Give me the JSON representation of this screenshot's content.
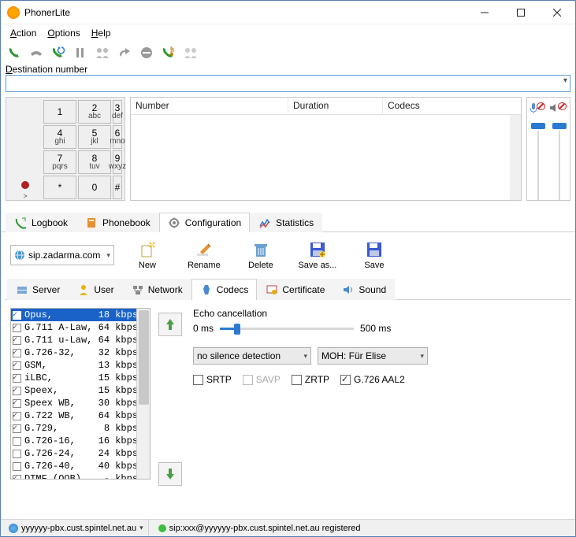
{
  "window": {
    "title": "PhonerLite"
  },
  "menu": {
    "action": "Action",
    "options": "Options",
    "help": "Help"
  },
  "dest_label": "Destination number",
  "keypad": [
    {
      "d": "1",
      "l": ""
    },
    {
      "d": "2",
      "l": "abc"
    },
    {
      "d": "3",
      "l": "def"
    },
    {
      "d": "4",
      "l": "ghi"
    },
    {
      "d": "5",
      "l": "jkl"
    },
    {
      "d": "6",
      "l": "mno"
    },
    {
      "d": "7",
      "l": "pqrs"
    },
    {
      "d": "8",
      "l": "tuv"
    },
    {
      "d": "9",
      "l": "wxyz"
    },
    {
      "d": "*",
      "l": ""
    },
    {
      "d": "0",
      "l": ""
    },
    {
      "d": "#",
      "l": ""
    }
  ],
  "call_columns": {
    "number": "Number",
    "duration": "Duration",
    "codecs": "Codecs"
  },
  "tabs": {
    "logbook": "Logbook",
    "phonebook": "Phonebook",
    "configuration": "Configuration",
    "statistics": "Statistics"
  },
  "profile": {
    "selected": "sip.zadarma.com"
  },
  "profile_actions": {
    "new": "New",
    "rename": "Rename",
    "delete": "Delete",
    "saveas": "Save as...",
    "save": "Save"
  },
  "subtabs": {
    "server": "Server",
    "user": "User",
    "network": "Network",
    "codecs": "Codecs",
    "certificate": "Certificate",
    "sound": "Sound"
  },
  "codecs": [
    {
      "checked": true,
      "name": "Opus,",
      "rate": "18 kbps",
      "sel": true
    },
    {
      "checked": true,
      "name": "G.711 A-Law,",
      "rate": "64 kbps"
    },
    {
      "checked": true,
      "name": "G.711 u-Law,",
      "rate": "64 kbps"
    },
    {
      "checked": true,
      "name": "G.726-32,",
      "rate": "32 kbps"
    },
    {
      "checked": true,
      "name": "GSM,",
      "rate": "13 kbps"
    },
    {
      "checked": true,
      "name": "iLBC,",
      "rate": "15 kbps"
    },
    {
      "checked": true,
      "name": "Speex,",
      "rate": "15 kbps"
    },
    {
      "checked": true,
      "name": "Speex WB,",
      "rate": "30 kbps"
    },
    {
      "checked": true,
      "name": "G.722 WB,",
      "rate": "64 kbps"
    },
    {
      "checked": true,
      "name": "G.729,",
      "rate": " 8 kbps"
    },
    {
      "checked": false,
      "name": "G.726-16,",
      "rate": "16 kbps"
    },
    {
      "checked": false,
      "name": "G.726-24,",
      "rate": "24 kbps"
    },
    {
      "checked": false,
      "name": "G.726-40,",
      "rate": "40 kbps"
    },
    {
      "checked": true,
      "name": "DTMF (OOB),",
      "rate": " - kbps"
    }
  ],
  "echo": {
    "label": "Echo cancellation",
    "min": "0 ms",
    "max": "500 ms"
  },
  "silence_dd": "no silence detection",
  "moh_dd": "MOH: Für Elise",
  "checks": {
    "srtp": "SRTP",
    "savp": "SAVP",
    "zrtp": "ZRTP",
    "aal2": "G.726 AAL2"
  },
  "status": {
    "server": "yyyyyy-pbx.cust.spintel.net.au",
    "msg": "sip:xxx@yyyyyy-pbx.cust.spintel.net.au  registered"
  }
}
